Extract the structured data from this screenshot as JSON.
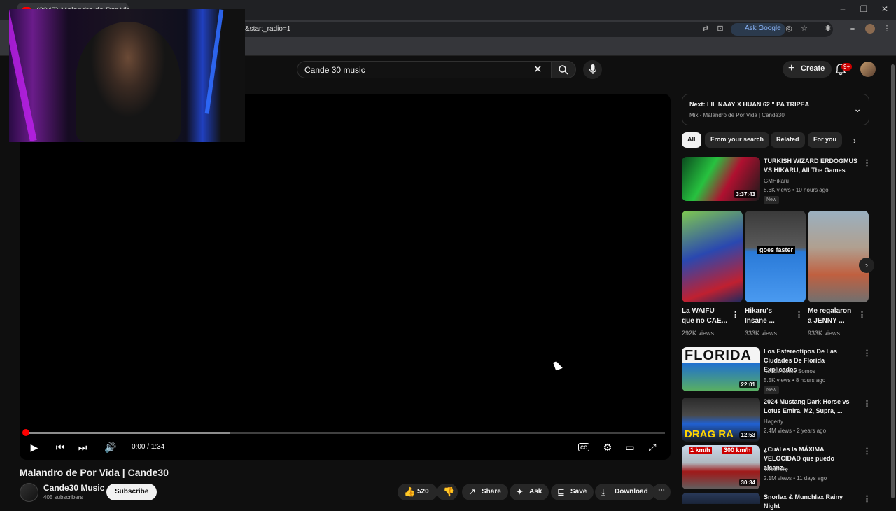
{
  "browser": {
    "tab_title": "(2047) Malandro de Por Vida |",
    "url_suffix": "&start_radio=1",
    "ask_google": "Ask Google"
  },
  "header": {
    "search_value": "Cande 30 music",
    "create_label": "Create",
    "notifications_badge": "9+"
  },
  "player": {
    "time": "0:00 / 1:34",
    "progress_fraction": 0.0,
    "buffer_fraction": 0.32
  },
  "video": {
    "title": "Malandro de Por Vida | Cande30",
    "channel": "Cande30 Music",
    "subscribers": "405 subscribers",
    "subscribe_label": "Subscribe",
    "likes": "520",
    "share_label": "Share",
    "ask_label": "Ask",
    "save_label": "Save",
    "download_label": "Download"
  },
  "up_next": {
    "title": "Next: LIL NAAY X HUAN 62 \" PA TRIPEA",
    "subtitle": "Mix - Malandro de Por Vida | Cande30"
  },
  "chips": [
    "All",
    "From your search",
    "Related",
    "For you"
  ],
  "recommendations": [
    {
      "title": "TURKISH WIZARD ERDOGMUS VS HIKARU, All The Games",
      "channel": "GMHikaru",
      "meta": "8.6K views • 10 hours ago",
      "duration": "3:37:43",
      "badge": "New"
    },
    {
      "title": "Los Estereotipos De Las Ciudades De Florida Explicados",
      "channel": "Así Es Como Somos",
      "meta": "5.5K views • 8 hours ago",
      "duration": "22:01",
      "badge": "New"
    },
    {
      "title": "2024 Mustang Dark Horse vs Lotus Emira, M2, Supra, ...",
      "channel": "Hagerty",
      "meta": "2.4M views • 2 years ago",
      "duration": "12:53",
      "badge": ""
    },
    {
      "title": "¿Cuál es la MÁXIMA VELOCIDAD que puedo alcanz...",
      "channel": "TheGrefg",
      "meta": "2.1M views • 11 days ago",
      "duration": "30:34",
      "badge": ""
    },
    {
      "title": "Snorlax & Munchlax Rainy Night",
      "channel": "",
      "meta": "",
      "duration": "",
      "badge": ""
    }
  ],
  "shorts": [
    {
      "title": "La WAIFU que no CAE...",
      "views": "292K views",
      "overlay": ""
    },
    {
      "title": "Hikaru's Insane ...",
      "views": "333K views",
      "overlay": "goes faster"
    },
    {
      "title": "Me regalaron a JENNY ...",
      "views": "933K views",
      "overlay": ""
    }
  ],
  "thumb_texts": {
    "florida": "FLORIDA",
    "drag": "DRAG RA",
    "kmh_left": "1 km/h",
    "kmh_right": "300 km/h"
  },
  "colors": {
    "accent_red": "#ff0000",
    "background": "#0f0f0f"
  }
}
